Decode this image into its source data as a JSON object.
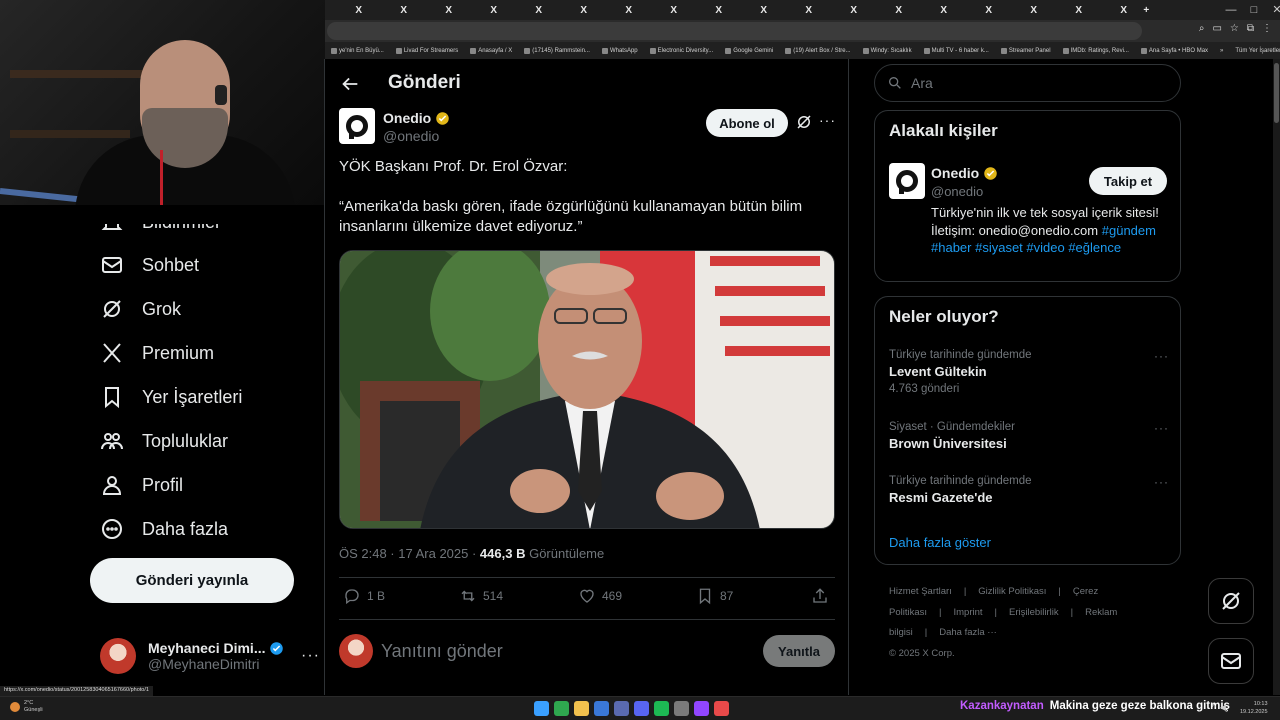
{
  "browser": {
    "tab_glyph": "X",
    "new_tab_label": "+",
    "window_controls": [
      "—",
      "□",
      "✕"
    ],
    "toolbar_icons": [
      "search-icon",
      "cast-icon",
      "star-icon",
      "extensions-icon",
      "menu-icon"
    ],
    "bookmarks": [
      "ye'nin En Büyü...",
      "Livad For Streamers",
      "Anasayfa / X",
      "(17145) Rammstein...",
      "WhatsApp",
      "Electronic Diversity...",
      "Google Gemini",
      "(19) Alert Box / Stre...",
      "Windy: Sıcaklık",
      "Multi TV - 6 haber k...",
      "Streamer Panel",
      "IMDb: Ratings, Revi...",
      "Ana Sayfa • HBO Max"
    ],
    "bookmarks_overflow": "»",
    "all_bookmarks": "Tüm Yer İşaretleri"
  },
  "nav": {
    "items": [
      {
        "label": "Bildirimler",
        "icon": "bell-icon"
      },
      {
        "label": "Sohbet",
        "icon": "mail-icon"
      },
      {
        "label": "Grok",
        "icon": "grok-icon"
      },
      {
        "label": "Premium",
        "icon": "x-logo-icon"
      },
      {
        "label": "Yer İşaretleri",
        "icon": "bookmark-icon"
      },
      {
        "label": "Topluluklar",
        "icon": "communities-icon"
      },
      {
        "label": "Profil",
        "icon": "person-icon"
      },
      {
        "label": "Daha fazla",
        "icon": "more-circle-icon"
      }
    ],
    "post_button": "Gönderi yayınla"
  },
  "account": {
    "display_name": "Meyhaneci Dimi...",
    "handle": "@MeyhaneDimitri",
    "more": "···"
  },
  "post": {
    "page_title": "Gönderi",
    "author_name": "Onedio",
    "author_handle": "@onedio",
    "subscribe_label": "Abone ol",
    "more": "···",
    "text_lines": [
      "YÖK Başkanı Prof. Dr. Erol Özvar:",
      "“Amerika'da baskı gören, ifade özgürlüğünü kullanamayan bütün bilim insanlarını ülkemize davet ediyoruz.”"
    ],
    "time": "ÖS 2:48 · 17 Ara 2025 · ",
    "views_count": "446,3 B",
    "views_label": " Görüntüleme",
    "replies": "1 B",
    "reposts": "514",
    "likes": "469",
    "bookmarks": "87",
    "reply_placeholder": "Yanıtını gönder",
    "reply_button": "Yanıtla"
  },
  "sidebar": {
    "search_placeholder": "Ara",
    "related_title": "Alakalı kişiler",
    "related": {
      "name": "Onedio",
      "handle": "@onedio",
      "follow_label": "Takip et",
      "bio": "Türkiye'nin ilk ve tek sosyal içerik sitesi! İletişim: onedio@onedio.com",
      "tags": "#gündem #haber #siyaset #video #eğlence"
    },
    "trends_title": "Neler oluyor?",
    "trends": [
      {
        "category": "Türkiye tarihinde gündemde",
        "topic": "Levent Gültekin",
        "count": "4.763 gönderi"
      },
      {
        "category": "Siyaset · Gündemdekiler",
        "topic": "Brown Üniversitesi",
        "count": ""
      },
      {
        "category": "Türkiye tarihinde gündemde",
        "topic": "Resmi Gazete'de",
        "count": ""
      }
    ],
    "trend_more": "···",
    "show_more": "Daha fazla göster",
    "footer_links": [
      "Hizmet Şartları",
      "|",
      "Gizlilik Politikası",
      "|",
      "Çerez Politikası",
      "|",
      "Imprint",
      "|",
      "Erişilebilirlik",
      "|",
      "Reklam bilgisi",
      "|",
      "Daha fazla ···"
    ],
    "copyright": "© 2025 X Corp."
  },
  "status_url": "https://x.com/onedio/status/2001258304065167660/photo/1",
  "taskbar": {
    "temperature": "2°C",
    "weather": "Güneşli",
    "ticker_user": "Kazankaynatan",
    "ticker_text": "Makina geze geze balkona gitmiş",
    "time": "10:13",
    "date": "19.12.2025",
    "app_colors": [
      "#3aa0ff",
      "#2fa84f",
      "#f2c14e",
      "#3a78d8",
      "#5a6ab0",
      "#5865f2",
      "#1db954",
      "#7a7a7a",
      "#9146ff",
      "#e84a4a"
    ]
  },
  "colors": {
    "accent": "#1d9bf0",
    "verified_gold": "#e2b719",
    "verified_blue": "#1d9bf0",
    "ticker_user": "#c25cff"
  }
}
